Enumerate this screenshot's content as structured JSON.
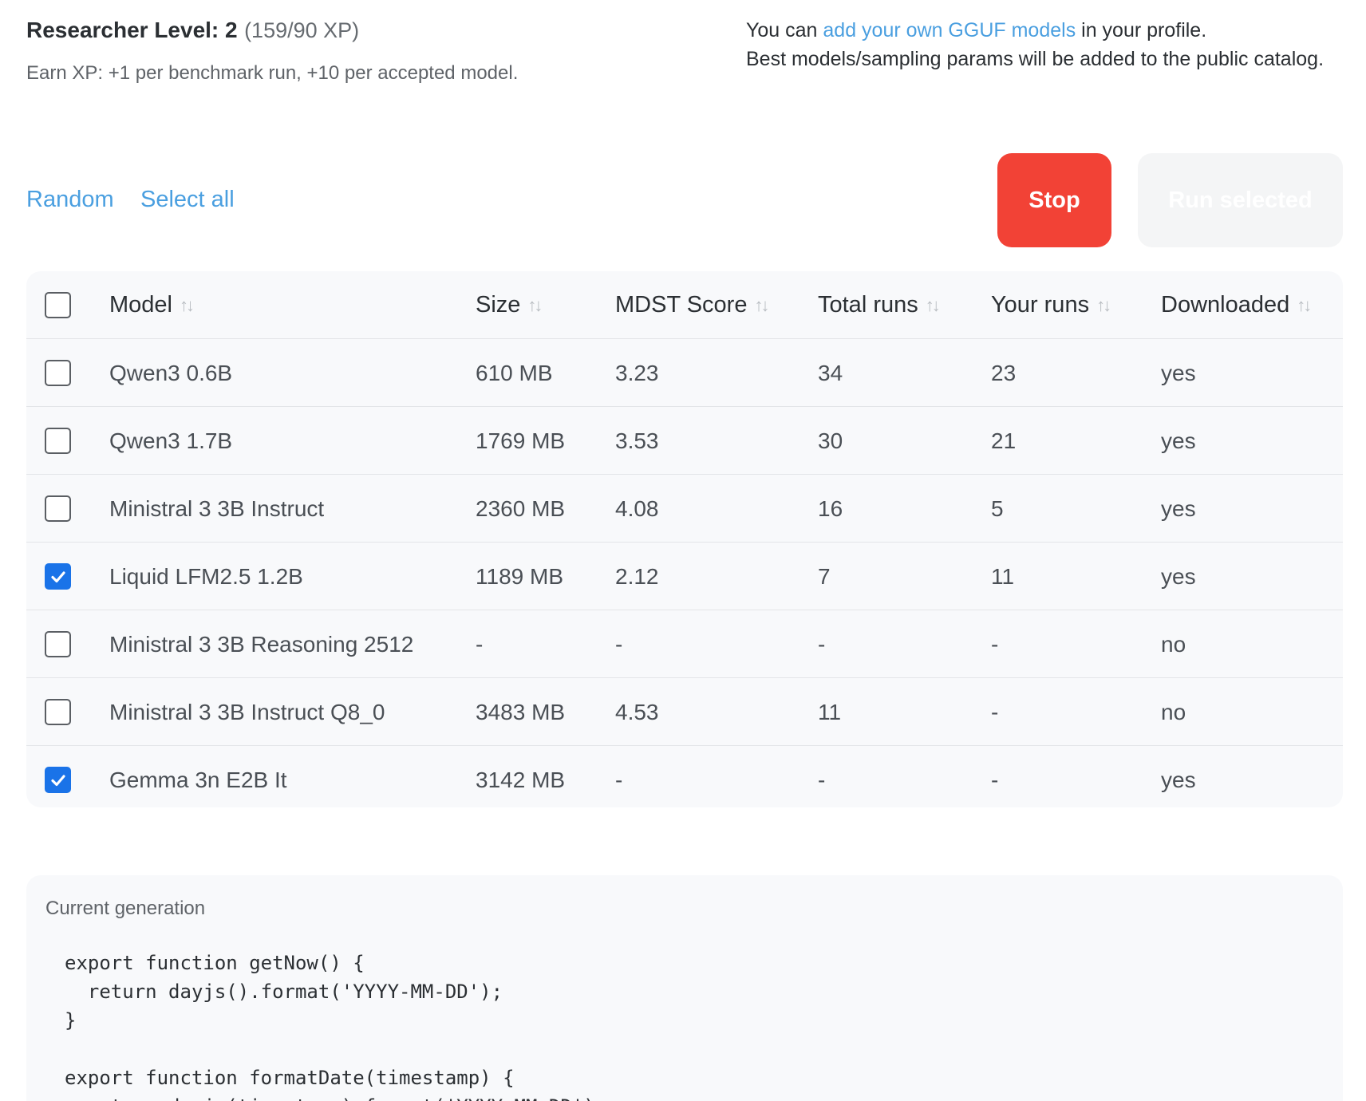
{
  "researcher": {
    "level_label": "Researcher Level: 2",
    "xp": "(159/90 XP)",
    "earn_text": "Earn XP: +1 per benchmark run, +10 per accepted model."
  },
  "notice": {
    "prefix": "You can ",
    "link": "add your own GGUF models",
    "suffix": " in your profile.",
    "line2": "Best models/sampling params will be added to the public catalog."
  },
  "actions": {
    "random": "Random",
    "select_all": "Select all",
    "stop": "Stop",
    "run_selected": "Run selected",
    "stop_color": "#f24236",
    "link_color": "#4a9fe0"
  },
  "table": {
    "columns": [
      "Model",
      "Size",
      "MDST Score",
      "Total runs",
      "Your runs",
      "Downloaded"
    ],
    "sort_icon": "sort-arrows-icon",
    "rows": [
      {
        "checked": false,
        "model": "Qwen3 0.6B",
        "size": "610 MB",
        "score": "3.23",
        "total": "34",
        "your": "23",
        "downloaded": "yes"
      },
      {
        "checked": false,
        "model": "Qwen3 1.7B",
        "size": "1769 MB",
        "score": "3.53",
        "total": "30",
        "your": "21",
        "downloaded": "yes"
      },
      {
        "checked": false,
        "model": "Ministral 3 3B Instruct",
        "size": "2360 MB",
        "score": "4.08",
        "total": "16",
        "your": "5",
        "downloaded": "yes"
      },
      {
        "checked": true,
        "model": "Liquid LFM2.5 1.2B",
        "size": "1189 MB",
        "score": "2.12",
        "total": "7",
        "your": "11",
        "downloaded": "yes"
      },
      {
        "checked": false,
        "model": "Ministral 3 3B Reasoning 2512",
        "size": "-",
        "score": "-",
        "total": "-",
        "your": "-",
        "downloaded": "no"
      },
      {
        "checked": false,
        "model": "Ministral 3 3B Instruct Q8_0",
        "size": "3483 MB",
        "score": "4.53",
        "total": "11",
        "your": "-",
        "downloaded": "no"
      },
      {
        "checked": true,
        "model": "Gemma 3n E2B It",
        "size": "3142 MB",
        "score": "-",
        "total": "-",
        "your": "-",
        "downloaded": "yes"
      }
    ]
  },
  "generation": {
    "title": "Current generation",
    "code": "export function getNow() {\n  return dayjs().format('YYYY-MM-DD');\n}\n\nexport function formatDate(timestamp) {\n  return dayjs(timestamp).format('YYYY-MM-DD');"
  }
}
